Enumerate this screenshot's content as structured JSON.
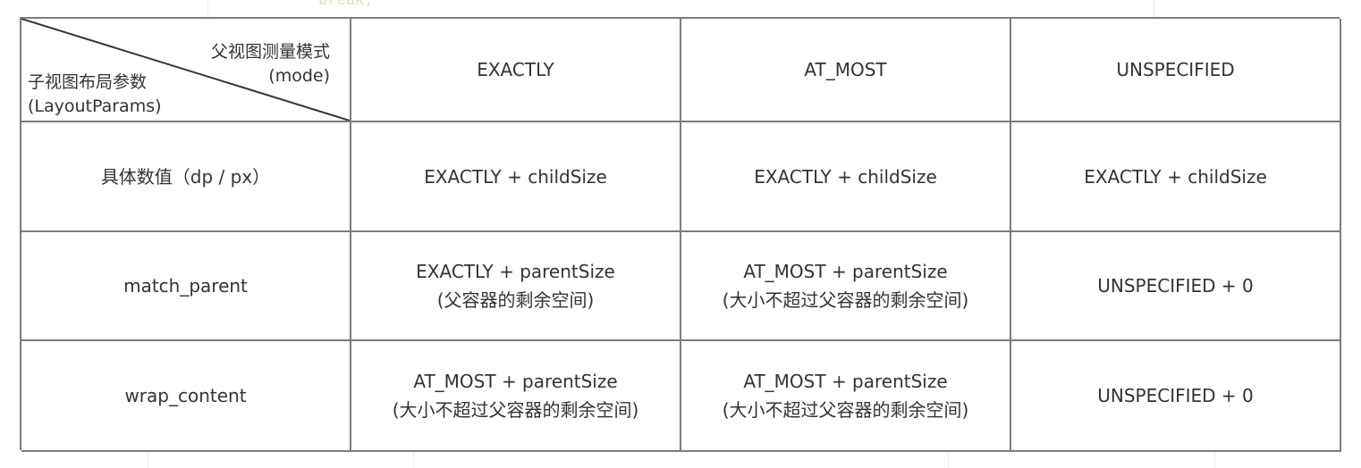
{
  "background": {
    "code_snippet": "break;"
  },
  "table": {
    "corner": {
      "column_axis_label": "父视图测量模式",
      "column_axis_sub": "(mode)",
      "row_axis_label": "子视图布局参数",
      "row_axis_sub": "(LayoutParams)"
    },
    "columns": [
      "EXACTLY",
      "AT_MOST",
      "UNSPECIFIED"
    ],
    "rows": [
      {
        "label": "具体数值（dp / px）",
        "cells": [
          [
            "EXACTLY + childSize"
          ],
          [
            "EXACTLY + childSize"
          ],
          [
            "EXACTLY + childSize"
          ]
        ]
      },
      {
        "label": "match_parent",
        "cells": [
          [
            "EXACTLY + parentSize",
            "(父容器的剩余空间)"
          ],
          [
            "AT_MOST + parentSize",
            "(大小不超过父容器的剩余空间)"
          ],
          [
            "UNSPECIFIED + 0"
          ]
        ]
      },
      {
        "label": "wrap_content",
        "cells": [
          [
            "AT_MOST + parentSize",
            "(大小不超过父容器的剩余空间)"
          ],
          [
            "AT_MOST + parentSize",
            "(大小不超过父容器的剩余空间)"
          ],
          [
            "UNSPECIFIED + 0"
          ]
        ]
      }
    ]
  }
}
